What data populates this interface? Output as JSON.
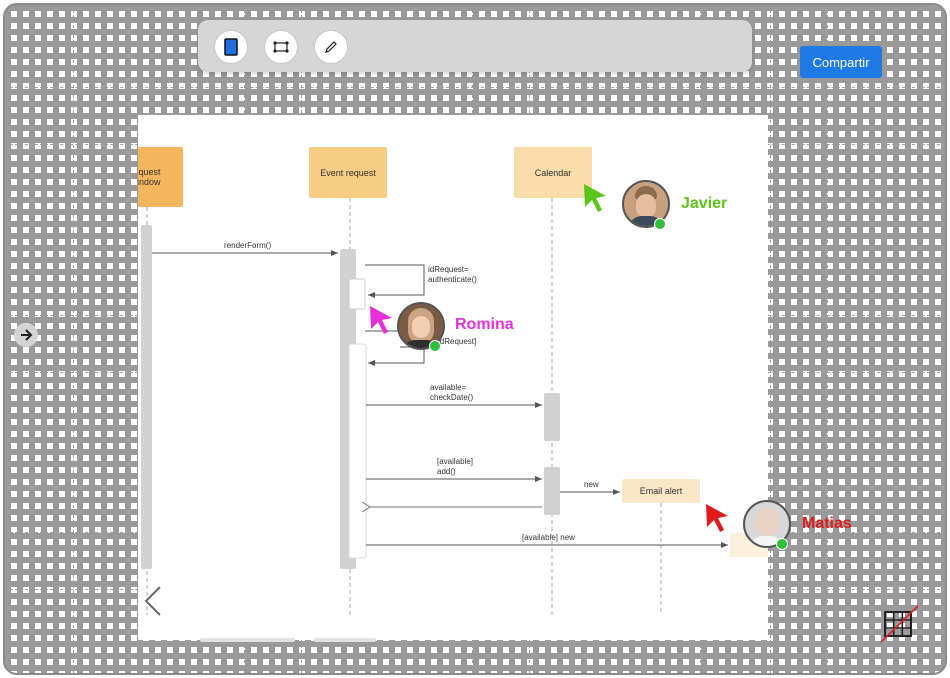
{
  "toolbar": {
    "tools": [
      {
        "name": "rectangle-tool",
        "icon": "rectangle-icon",
        "color": "#1f6fe0"
      },
      {
        "name": "connector-tool",
        "icon": "connector-icon"
      },
      {
        "name": "pencil-tool",
        "icon": "pencil-icon"
      }
    ]
  },
  "share_button": {
    "label": "Compartir",
    "color": "#1f7ae8"
  },
  "diagram": {
    "lifelines": [
      {
        "label": "request\nwindow",
        "color": "#f4b65c"
      },
      {
        "label": "Event request",
        "color": "#f7cd83"
      },
      {
        "label": "Calendar",
        "color": "#f8dca9"
      },
      {
        "label": "Email alert",
        "color": "#fae7c8"
      }
    ],
    "messages": {
      "render_form": "renderForm()",
      "authenticate": "idRequest=\nauthenticate()",
      "id_request": "idRequest]",
      "check_date": "available=\ncheckDate()",
      "add": "[available]\nadd()",
      "new_calendar": "new",
      "new_email": "[available] new"
    }
  },
  "collaborators": [
    {
      "name": "Javier",
      "color": "#5cc51b"
    },
    {
      "name": "Romina",
      "color": "#e830d8"
    },
    {
      "name": "Matias",
      "color": "#e01b1b"
    }
  ]
}
